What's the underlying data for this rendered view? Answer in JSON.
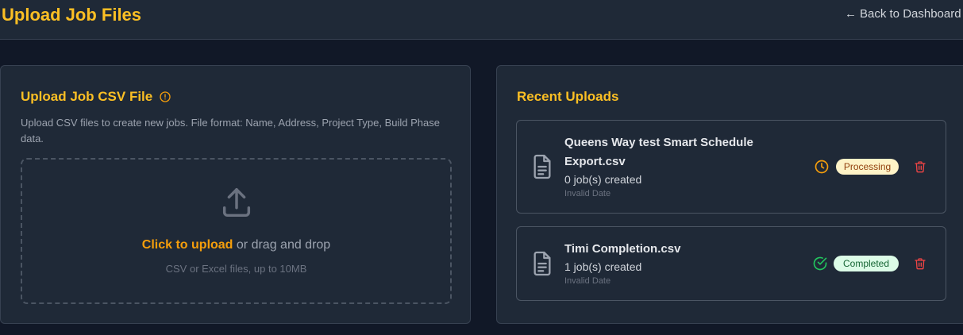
{
  "header": {
    "title": "Upload Job Files",
    "back_arrow": "←",
    "back_label": "Back to Dashboard"
  },
  "upload_card": {
    "title": "Upload Job CSV File",
    "description": "Upload CSV files to create new jobs. File format: Name, Address, Project Type, Build Phase data.",
    "dropzone": {
      "click_label": "Click to upload",
      "drag_label": " or drag and drop",
      "hint": "CSV or Excel files, up to 10MB"
    }
  },
  "recent_card": {
    "title": "Recent Uploads",
    "items": [
      {
        "file_name": "Queens Way test Smart Schedule Export.csv",
        "jobs_created": "0 job(s) created",
        "date": "Invalid Date",
        "status": "Processing",
        "status_icon": "clock-icon",
        "status_color": "#f59e0b"
      },
      {
        "file_name": "Timi Completion.csv",
        "jobs_created": "1 job(s) created",
        "date": "Invalid Date",
        "status": "Completed",
        "status_icon": "check-circle-icon",
        "status_color": "#22c55e"
      }
    ]
  },
  "colors": {
    "accent": "#fbbf24",
    "background": "#111827",
    "card": "#1f2937",
    "danger": "#ef4444"
  }
}
